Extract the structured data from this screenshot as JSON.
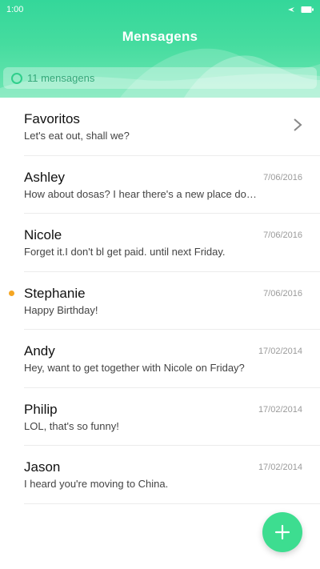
{
  "status_bar": {
    "time": "1:00"
  },
  "header": {
    "title": "Mensagens",
    "search_label": "11 mensagens"
  },
  "conversations": [
    {
      "name": "Favoritos",
      "preview": "Let's eat out, shall we?",
      "date": "",
      "unread": false
    },
    {
      "name": "Ashley",
      "preview": "How about dosas? I hear there's a new place do…",
      "date": "7/06/2016",
      "unread": false
    },
    {
      "name": "Nicole",
      "preview": "Forget it.I don't bl get paid. until next Friday.",
      "date": "7/06/2016",
      "unread": false
    },
    {
      "name": "Stephanie",
      "preview": "Happy Birthday!",
      "date": "7/06/2016",
      "unread": true
    },
    {
      "name": "Andy",
      "preview": "Hey, want to get together with Nicole on Friday?",
      "date": "17/02/2014",
      "unread": false
    },
    {
      "name": "Philip",
      "preview": "LOL, that's so funny!",
      "date": "17/02/2014",
      "unread": false
    },
    {
      "name": "Jason",
      "preview": "I heard you're moving to China.",
      "date": "17/02/2014",
      "unread": false
    }
  ],
  "icons": {
    "chevron": "chevron-right-icon",
    "fab": "plus-icon",
    "search": "circle-search-icon"
  },
  "colors": {
    "accent": "#3ddd90",
    "unread_dot": "#f5a623"
  }
}
